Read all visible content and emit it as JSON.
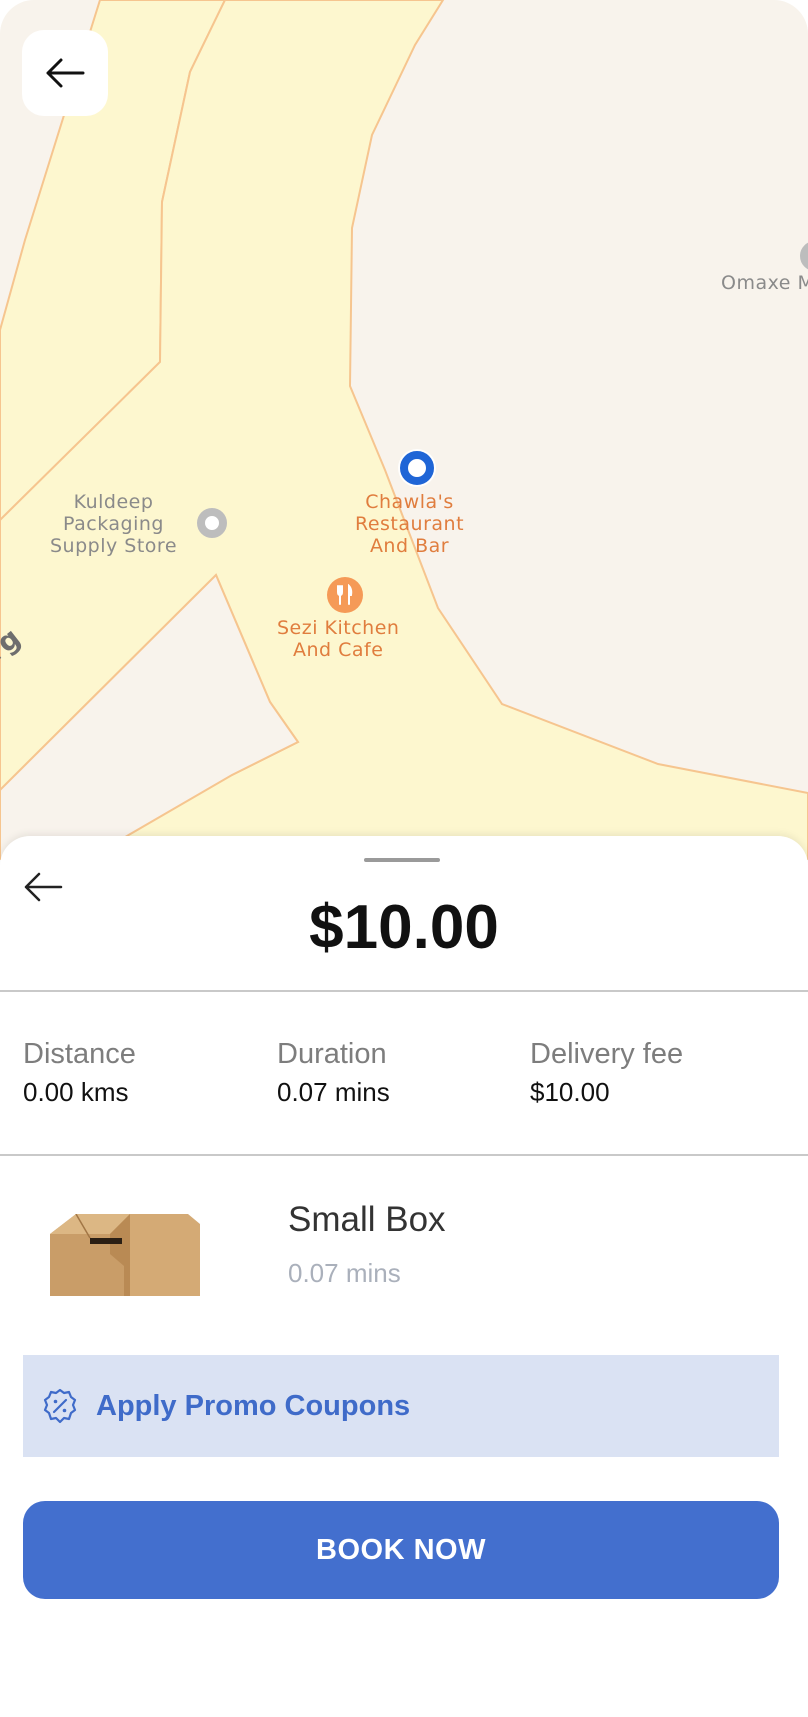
{
  "map": {
    "labels": {
      "kuldeep": "Kuldeep\nPackaging\nSupply Store",
      "chawla": "Chawla's\nRestaurant\nAnd Bar",
      "sezi": "Sezi Kitchen\nAnd Cafe",
      "omaxe": "Omaxe M",
      "street_partial": "rg"
    },
    "back_icon": "arrow-left-icon",
    "colors": {
      "road_fill": "#fdf7cf",
      "road_edge": "#f6c58f",
      "land": "#f8f3ec",
      "pin": "#1f65d6"
    }
  },
  "sheet": {
    "price": "$10.00",
    "stats": [
      {
        "label": "Distance",
        "value": "0.00 kms"
      },
      {
        "label": "Duration",
        "value": "0.07 mins"
      },
      {
        "label": "Delivery fee",
        "value": "$10.00"
      }
    ],
    "item": {
      "title": "Small Box",
      "subtitle": "0.07 mins"
    },
    "promo": {
      "label": "Apply Promo Coupons",
      "icon": "discount-badge-icon"
    },
    "book_button": "BOOK NOW"
  }
}
